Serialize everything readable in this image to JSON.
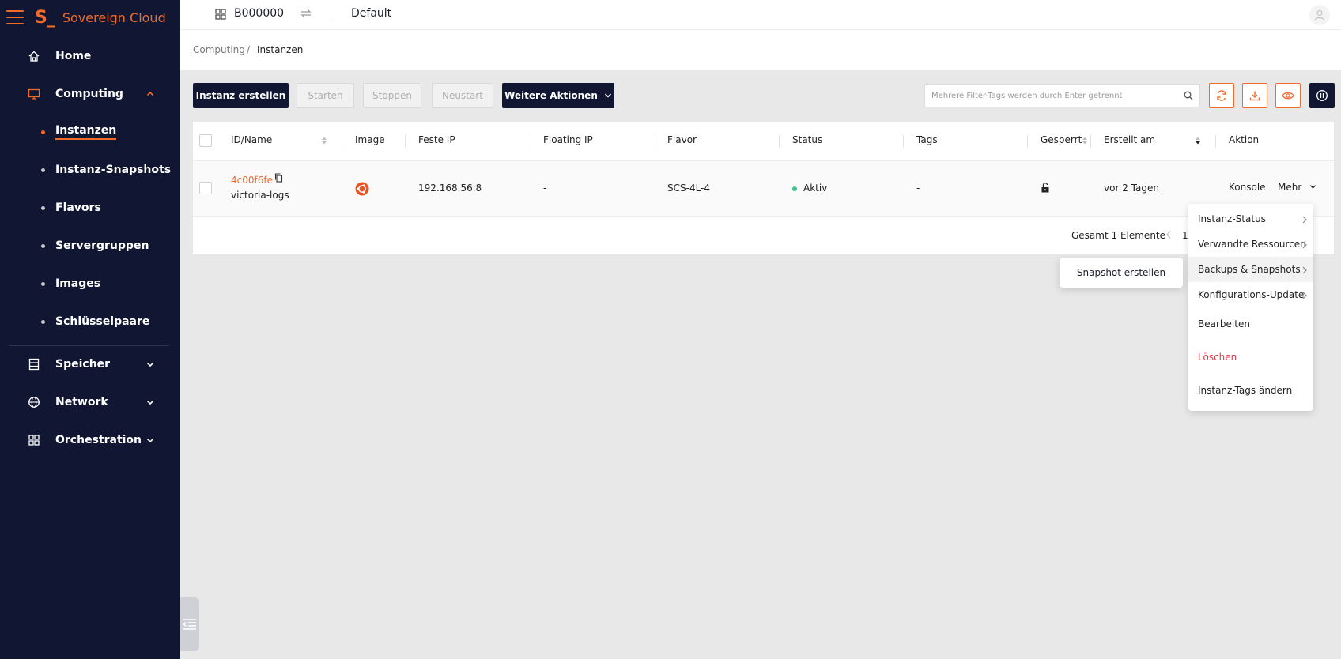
{
  "app": {
    "brand_mark": "S_",
    "brand_name": "Sovereign Cloud"
  },
  "topbar": {
    "project_id": "B000000",
    "domain": "Default"
  },
  "sidebar": {
    "items": [
      {
        "label": "Home",
        "icon": "home-icon"
      },
      {
        "label": "Computing",
        "icon": "monitor-icon",
        "expanded": true
      },
      {
        "label": "Speicher",
        "icon": "storage-icon",
        "expanded": false
      },
      {
        "label": "Network",
        "icon": "globe-icon",
        "expanded": false
      },
      {
        "label": "Orchestration",
        "icon": "grid-icon",
        "expanded": false
      }
    ],
    "computing_children": [
      "Instanzen",
      "Instanz-Snapshots",
      "Flavors",
      "Servergruppen",
      "Images",
      "Schlüsselpaare"
    ],
    "active_child": "Instanzen"
  },
  "breadcrumb": {
    "parent": "Computing",
    "separator": "/",
    "current": "Instanzen"
  },
  "toolbar": {
    "create_label": "Instanz erstellen",
    "start_label": "Starten",
    "stop_label": "Stoppen",
    "restart_label": "Neustart",
    "more_actions_label": "Weitere Aktionen",
    "search_placeholder": "Mehrere Filter-Tags werden durch Enter getrennt"
  },
  "table": {
    "columns": [
      "ID/Name",
      "Image",
      "Feste IP",
      "Floating IP",
      "Flavor",
      "Status",
      "Tags",
      "Gesperrt",
      "Erstellt am",
      "Aktion"
    ],
    "rows": [
      {
        "id": "4c00f6fe",
        "name": "victoria-logs",
        "image_icon": "ubuntu-icon",
        "fixed_ip": "192.168.56.8",
        "floating_ip": "-",
        "flavor": "SCS-4L-4",
        "status": "Aktiv",
        "tags": "-",
        "locked_icon": "unlock-icon",
        "created": "vor 2 Tagen",
        "action_console": "Konsole",
        "action_more": "Mehr"
      }
    ]
  },
  "pagination": {
    "total_label": "Gesamt 1 Elemente",
    "page": "1"
  },
  "more_menu": {
    "items": [
      "Instanz-Status",
      "Verwandte Ressourcen",
      "Backups & Snapshots",
      "Konfigurations-Update",
      "Bearbeiten",
      "Löschen",
      "Instanz-Tags ändern"
    ],
    "submenu": [
      "Snapshot erstellen"
    ]
  },
  "colors": {
    "accent": "#f06a2a",
    "sidebar_bg": "#111733",
    "status_active": "#3cc48a",
    "danger": "#d8384a"
  }
}
